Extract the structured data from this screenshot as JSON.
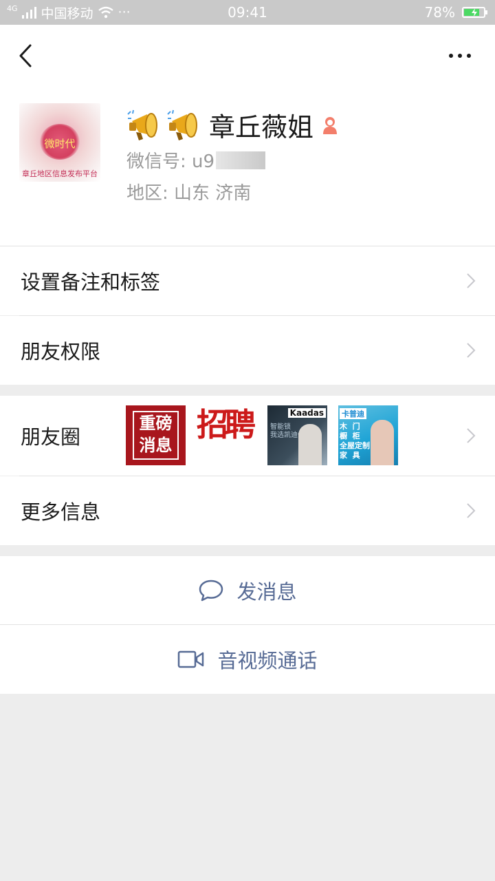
{
  "status_bar": {
    "network": "4G",
    "carrier": "中国移动",
    "dots": "···",
    "time": "09:41",
    "battery": "78%",
    "battery_level": 0.78
  },
  "profile": {
    "avatar_top_text": "微时代",
    "avatar_bottom_text": "章丘地区信息发布平台",
    "nickname": "章丘薇姐",
    "wechat_id_label": "微信号: u9",
    "region_label": "地区: 山东  济南"
  },
  "menu": {
    "remark_tags": "设置备注和标签",
    "friend_permissions": "朋友权限",
    "moments": "朋友圈",
    "more_info": "更多信息"
  },
  "moments_thumbs": {
    "t1": "重磅消息",
    "t2": "招聘",
    "t3_brand": "Kaadas",
    "t3_sub": "智能锁\n我选凯迪仕",
    "t4_brand": "卡普迪",
    "t4_lines": "木  门\n橱  柜\n全屋定制\n家  具"
  },
  "actions": {
    "send_message": "发消息",
    "video_call": "音视频通话"
  },
  "colors": {
    "link_blue": "#576b95",
    "status_bar_bg": "#c9c9c9",
    "page_bg": "#ededed",
    "gender_female": "#f37e6b"
  },
  "icons": {
    "back": "back-arrow-icon",
    "more": "more-icon",
    "horn": "megaphone-icon",
    "gender": "female-gender-icon",
    "chevron": "chevron-right-icon",
    "chat": "chat-bubble-icon",
    "video": "video-camera-icon",
    "wifi": "wifi-icon",
    "signal": "signal-icon",
    "battery": "battery-icon"
  }
}
